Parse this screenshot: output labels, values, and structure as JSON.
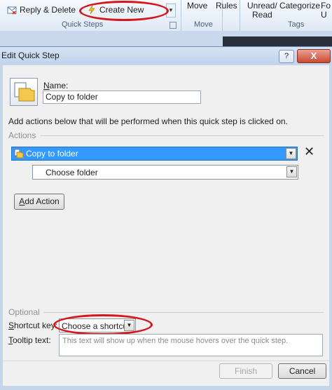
{
  "ribbon": {
    "reply_delete": "Reply & Delete",
    "create_new": "Create New",
    "quick_steps_label": "Quick Steps",
    "move": "Move",
    "rules": "Rules",
    "move_group_label": "Move",
    "unread_read_line1": "Unread/",
    "unread_read_line2": "Read",
    "categorize": "Categorize",
    "follow_up": "Fo",
    "follow_up_line2": "U",
    "tags_label": "Tags"
  },
  "dialog": {
    "title": "Edit Quick Step",
    "help_label": "?",
    "close_label": "X",
    "name_label": "Name:",
    "name_value": "Copy to folder",
    "instructions": "Add actions below that will be performed when this quick step is clicked on.",
    "actions_heading": "Actions",
    "action_selected": "Copy to folder",
    "folder_choice": "Choose folder",
    "remove_label": "✕",
    "add_action_label": "Add Action",
    "optional_heading": "Optional",
    "shortcut_label": "Shortcut key:",
    "shortcut_value": "Choose a shortcut",
    "tooltip_label": "Tooltip text:",
    "tooltip_placeholder": "This text will show up when the mouse hovers over the quick step.",
    "finish_label": "Finish",
    "cancel_label": "Cancel"
  },
  "colors": {
    "highlight": "#d5161b",
    "selection": "#3399ff",
    "dialog_bg": "#f0f0f0"
  }
}
